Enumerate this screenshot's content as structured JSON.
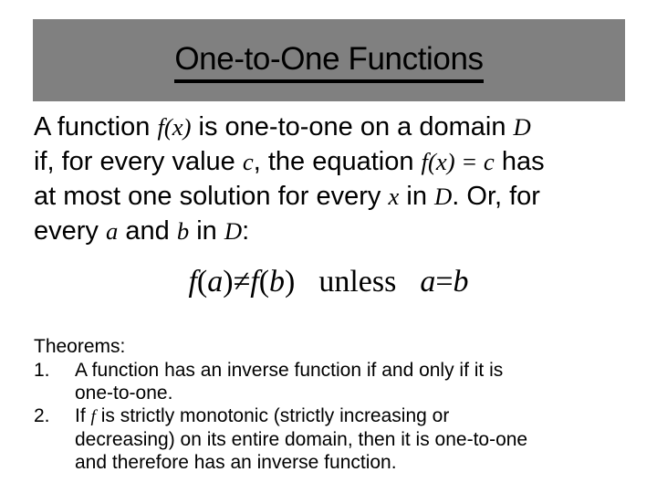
{
  "slide": {
    "background_color": "#ffffff",
    "title_band_color": "#808080",
    "text_color": "#000000",
    "title": "One-to-One Functions"
  },
  "definition": {
    "line1": {
      "pre": "A function ",
      "m1": "f",
      "m1b": "(x)",
      "mid": " is one-to-one on a domain ",
      "m2": "D"
    },
    "line2": {
      "pre": "if, for every value ",
      "m1": "c",
      "mid": ", the equation ",
      "m2": "f",
      "m2b": "(x)",
      "m2c": " = ",
      "m2d": "c",
      "post": " has"
    },
    "line3": {
      "pre": "at most one solution for every ",
      "m1": "x",
      "mid": " in ",
      "m2": "D",
      "post": ". Or, for"
    },
    "line4": {
      "pre": "every ",
      "m1": "a",
      "mid": " and ",
      "m2": "b",
      "post": " in ",
      "m3": "D",
      "end": ":"
    }
  },
  "equation": {
    "lhs_f": "f",
    "lhs_open": "(",
    "lhs_arg": "a",
    "lhs_close": ")",
    "relation": "≠",
    "rhs_f": "f",
    "rhs_open": "(",
    "rhs_arg": "b",
    "rhs_close": ")",
    "connector": "unless",
    "cond_left": "a",
    "cond_rel": "=",
    "cond_right": "b",
    "plain_text": "f(a) ≠ f(b)  unless  a = b"
  },
  "theorems": {
    "heading": "Theorems:",
    "items": [
      {
        "number": "1.",
        "line1": "A function has an inverse function if and only if it is",
        "line2": "one-to-one."
      },
      {
        "number": "2.",
        "line1_pre": "If ",
        "line1_math": "f",
        "line1_post": " is strictly monotonic (strictly increasing or",
        "line2": "decreasing) on its entire domain, then it is one-to-one",
        "line3": "and therefore has an inverse function."
      }
    ]
  }
}
